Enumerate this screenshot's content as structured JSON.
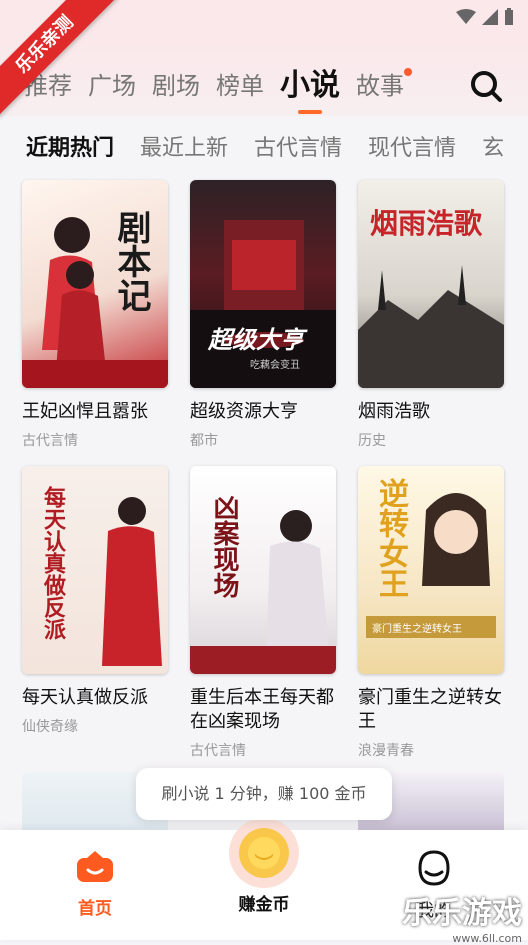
{
  "ribbon": "乐乐亲测",
  "tabs": [
    {
      "label": "推荐"
    },
    {
      "label": "广场"
    },
    {
      "label": "剧场"
    },
    {
      "label": "榜单"
    },
    {
      "label": "小说"
    },
    {
      "label": "故事"
    }
  ],
  "subtabs": [
    "近期热门",
    "最近上新",
    "古代言情",
    "现代言情",
    "玄"
  ],
  "books": [
    {
      "title": "王妃凶悍且嚣张",
      "category": "古代言情",
      "cover_text": "剧本记"
    },
    {
      "title": "超级资源大亨",
      "category": "都市",
      "cover_text": "超级大亨",
      "cover_sub": "吃藕会变丑"
    },
    {
      "title": "烟雨浩歌",
      "category": "历史",
      "cover_text": "烟雨浩歌"
    },
    {
      "title": "每天认真做反派",
      "category": "仙侠奇缘",
      "cover_text": "每天认真做反派"
    },
    {
      "title": "重生后本王每天都在凶案现场",
      "category": "古代言情",
      "cover_text": "凶案现场"
    },
    {
      "title": "豪门重生之逆转女王",
      "category": "浪漫青春",
      "cover_text": "逆转女王",
      "cover_sub": "豪门重生之逆转女王"
    }
  ],
  "toast": "刷小说 1 分钟，赚 100 金币",
  "nav": {
    "home": "首页",
    "earn": "赚金币",
    "profile": "我的"
  },
  "watermark": {
    "big": "乐乐游戏",
    "small": "www.6ll.com"
  },
  "colors": {
    "accent": "#ff5a1f",
    "ribbon": "#e02a2a"
  }
}
